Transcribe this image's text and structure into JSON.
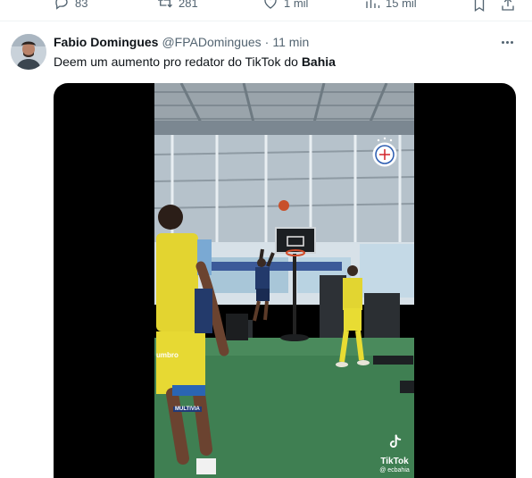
{
  "actions": {
    "replies": "83",
    "retweets": "281",
    "likes": "1 mil",
    "views": "15 mil"
  },
  "tweet": {
    "name": "Fabio Domingues",
    "handle": "@FPADomingues",
    "separator": "·",
    "time": "11 min",
    "text_prefix": "Deem um aumento pro redator do TikTok do ",
    "text_bold": "Bahia"
  },
  "video": {
    "watermark_label": "TikTok",
    "watermark_user": "@ ecbahia",
    "shirt_brand": "umbro",
    "shorts_sponsor": "MULTIVIA"
  },
  "icons": {
    "reply": "reply-icon",
    "retweet": "retweet-icon",
    "like": "heart-icon",
    "views": "views-icon",
    "bookmark": "bookmark-icon",
    "share": "share-icon",
    "more": "more-icon",
    "tiktok": "tiktok-logo-icon",
    "crest": "club-crest-icon"
  }
}
